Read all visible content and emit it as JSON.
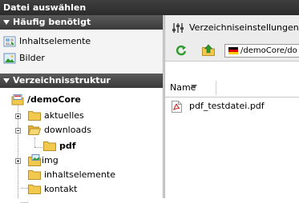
{
  "window": {
    "title": "Datei auswählen"
  },
  "favorites": {
    "header": "Häufig benötigt",
    "items": [
      {
        "label": "Inhaltselemente",
        "icon": "content-elements-icon"
      },
      {
        "label": "Bilder",
        "icon": "images-icon"
      }
    ]
  },
  "tree": {
    "header": "Verzeichnisstruktur",
    "root": {
      "label": "/demoCore",
      "icon": "site-root-icon"
    },
    "nodes": [
      {
        "label": "aktuelles",
        "expander": "plus"
      },
      {
        "label": "downloads",
        "expander": "minus",
        "open": true
      },
      {
        "label": "pdf",
        "child": true,
        "selected": true
      },
      {
        "label": "img",
        "expander": "plus"
      },
      {
        "label": "inhaltselemente",
        "expander": ""
      },
      {
        "label": "kontakt",
        "expander": ""
      }
    ]
  },
  "toolbar": {
    "settings_label": "Verzeichniseinstellungen",
    "path_value": "/demoCore/do"
  },
  "filelist": {
    "column_name": "Name",
    "files": [
      {
        "name": "pdf_testdatei.pdf",
        "icon": "pdf-file-icon"
      }
    ]
  },
  "colors": {
    "accent_green": "#2e9a2e",
    "folder": "#f2c94c",
    "pdf_red": "#cc2222"
  }
}
